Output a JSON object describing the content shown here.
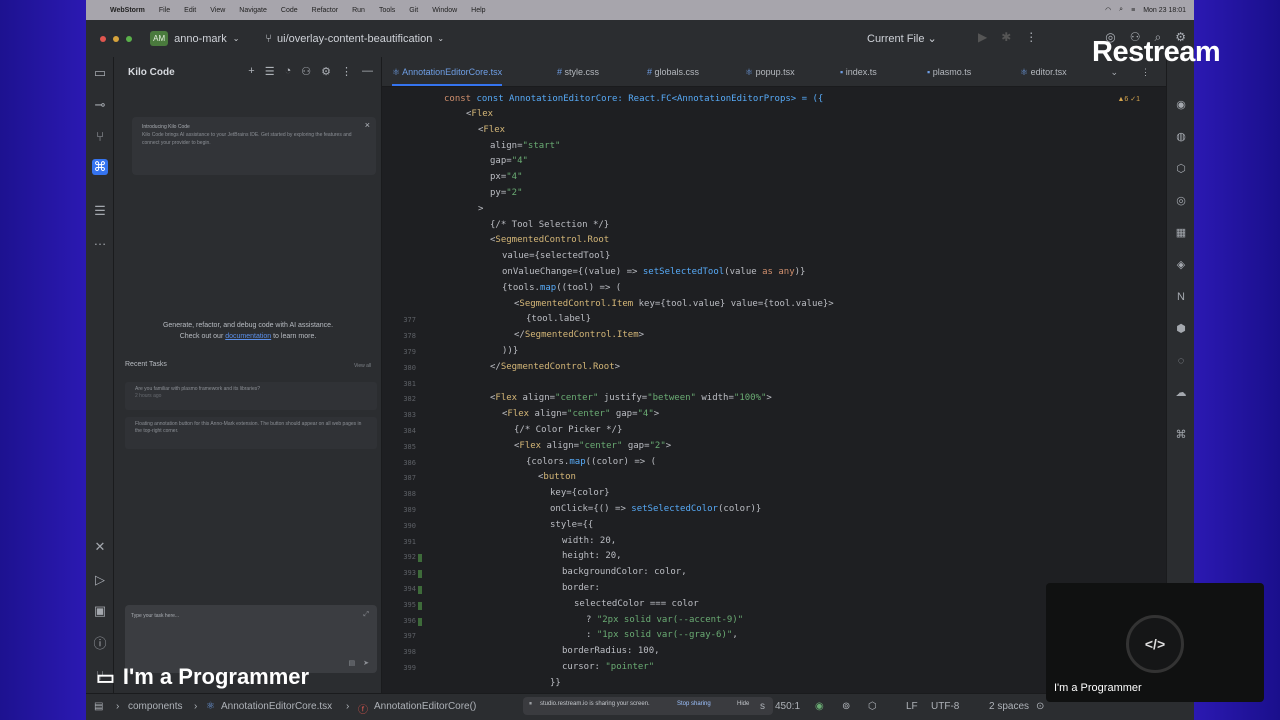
{
  "menubar": {
    "app": "WebStorm",
    "items": [
      "File",
      "Edit",
      "View",
      "Navigate",
      "Code",
      "Refactor",
      "Run",
      "Tools",
      "Git",
      "Window",
      "Help"
    ],
    "clock": "Mon 23 18:01"
  },
  "titlebar": {
    "project_badge": "AM",
    "project": "anno-mark",
    "branch": "ui/overlay-content-beautification",
    "run_config": "Current File"
  },
  "kilo": {
    "title": "Kilo Code",
    "notice_title": "Introducing Kilo Code",
    "notice_body": "Kilo Code brings AI assistance to your JetBrains IDE. Get started by exploring the features and connect your provider to begin.",
    "empty_line1": "Generate, refactor, and debug code with AI assistance.",
    "empty_line2_prefix": "Check out our ",
    "empty_link": "documentation",
    "empty_line2_suffix": " to learn more.",
    "recent_title": "Recent Tasks",
    "view_all": "View all",
    "task1": "Are you familiar with plasmo framework and its libraries?",
    "task1_meta": "2 hours ago",
    "task2": "Floating annotation button for this Anno-Mark extension. The button should appear on all web pages in the top-right corner.",
    "chat_placeholder": "Type your task here..."
  },
  "editor": {
    "tabs": [
      "AnnotationEditorCore.tsx",
      "style.css",
      "globals.css",
      "popup.tsx",
      "index.ts",
      "plasmo.ts",
      "editor.tsx"
    ],
    "signature": "const AnnotationEditorCore: React.FC<AnnotationEditorProps> = ({",
    "inspections": "▲6 ✓1",
    "line_numbers": [
      "",
      "",
      "",
      "",
      "",
      "",
      "",
      "",
      "",
      "",
      "",
      "",
      "",
      "377",
      "378",
      "379",
      "380",
      "381",
      "382",
      "383",
      "384",
      "385",
      "386",
      "387",
      "388",
      "389",
      "390",
      "391",
      "392",
      "393",
      "394",
      "395",
      "396",
      "397",
      "398",
      "399"
    ],
    "lines": [
      "<Flex",
      "  <Flex",
      "    align=\"start\"",
      "    gap=\"4\"",
      "    px=\"4\"",
      "    py=\"2\"",
      "  >",
      "    {/* Tool Selection */}",
      "    <SegmentedControl.Root",
      "      value={selectedTool}",
      "      onValueChange={(value) => setSelectedTool(value as any)}",
      "      {tools.map((tool) => (",
      "        <SegmentedControl.Item key={tool.value} value={tool.value}>",
      "          {tool.label}",
      "        </SegmentedControl.Item>",
      "      ))}",
      "    </SegmentedControl.Root>",
      "",
      "    <Flex align=\"center\" justify=\"between\" width=\"100%\">",
      "      <Flex align=\"center\" gap=\"4\">",
      "        {/* Color Picker */}",
      "        <Flex align=\"center\" gap=\"2\">",
      "          {colors.map((color) => (",
      "            <button",
      "              key={color}",
      "              onClick={() => setSelectedColor(color)}",
      "              style={{",
      "                width: 20,",
      "                height: 20,",
      "                backgroundColor: color,",
      "                border:",
      "                  selectedColor === color",
      "                    ? \"2px solid var(--accent-9)\"",
      "                    : \"1px solid var(--gray-6)\",",
      "                borderRadius: 100,",
      "                cursor: \"pointer\"",
      "              }}"
    ]
  },
  "statusbar": {
    "crumb1": "components",
    "crumb2": "AnnotationEditorCore.tsx",
    "crumb3": "AnnotationEditorCore()",
    "share_text": "studio.restream.io is sharing your screen.",
    "share_stop": "Stop sharing",
    "share_hide": "Hide",
    "position": "450:1",
    "line_sep": "LF",
    "encoding": "UTF-8",
    "indent": "2 spaces"
  },
  "overlay": {
    "brand": "Restream",
    "caption": "I'm a Programmer",
    "cam_name": "I'm a Programmer",
    "cam_avatar": "</>"
  },
  "colors": {
    "tag": "#d5b778",
    "attr": "#bcbec4",
    "string": "#6aab73",
    "func": "#57aaf7",
    "keyword": "#cf8e6d",
    "accent": "#3574f0"
  }
}
